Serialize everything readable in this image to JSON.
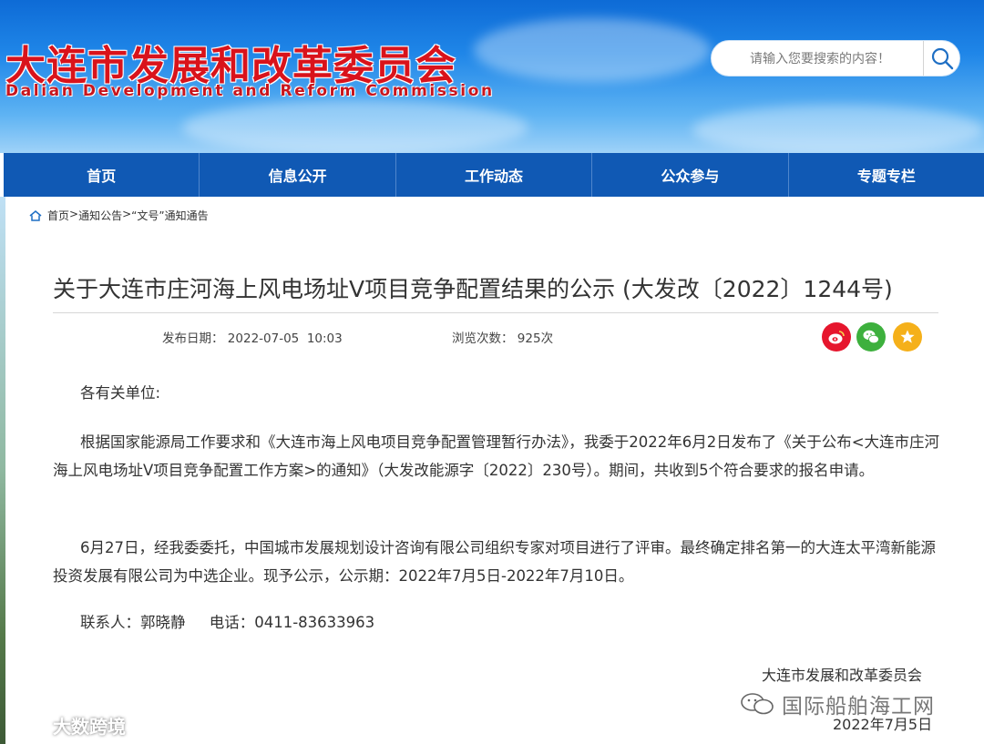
{
  "header": {
    "title": "大连市发展和改革委员会",
    "subtitle": "Dalian Development and Reform Commission",
    "search_placeholder": "请输入您要搜索的内容！"
  },
  "nav": {
    "items": [
      "首页",
      "信息公开",
      "工作动态",
      "公众参与",
      "专题专栏"
    ]
  },
  "breadcrumb": {
    "home": "首页",
    "sep1": ">",
    "level1": "通知公告",
    "sep2": ">",
    "level2": "“文号”通知通告"
  },
  "article": {
    "title": "关于大连市庄河海上风电场址Ⅴ项目竞争配置结果的公示 (大发改〔2022〕1244号)",
    "publish_label": "发布日期：",
    "publish_date": "2022-07-05  10:03",
    "views_label": "浏览次数：",
    "views": "925次",
    "salutation": "各有关单位:",
    "para1": "根据国家能源局工作要求和《大连市海上风电项目竞争配置管理暂行办法》，我委于2022年6月2日发布了《关于公布<大连市庄河海上风电场址V项目竞争配置工作方案>的通知》（大发改能源字〔2022〕230号）。期间，共收到5个符合要求的报名申请。",
    "para2": "6月27日，经我委委托，中国城市发展规划设计咨询有限公司组织专家对项目进行了评审。最终确定排名第一的大连太平湾新能源投资发展有限公司为中选企业。现予公示，公示期：2022年7月5日-2022年7月10日。",
    "contact": "联系人：郭晓静     电话：0411-83633963",
    "signature_org": "大连市发展和改革委员会",
    "signature_date": "2022年7月5日"
  },
  "share": {
    "icons": [
      "weibo-icon",
      "wechat-icon",
      "favorite-icon"
    ],
    "colors": {
      "weibo": "#e6162d",
      "wechat": "#3db03d",
      "favorite": "#f5b01a"
    }
  },
  "watermarks": {
    "left": "大数跨境",
    "right": "国际船舶海工网"
  },
  "colors": {
    "nav_bg": "#1059b4",
    "title_red": "#d9131b"
  }
}
